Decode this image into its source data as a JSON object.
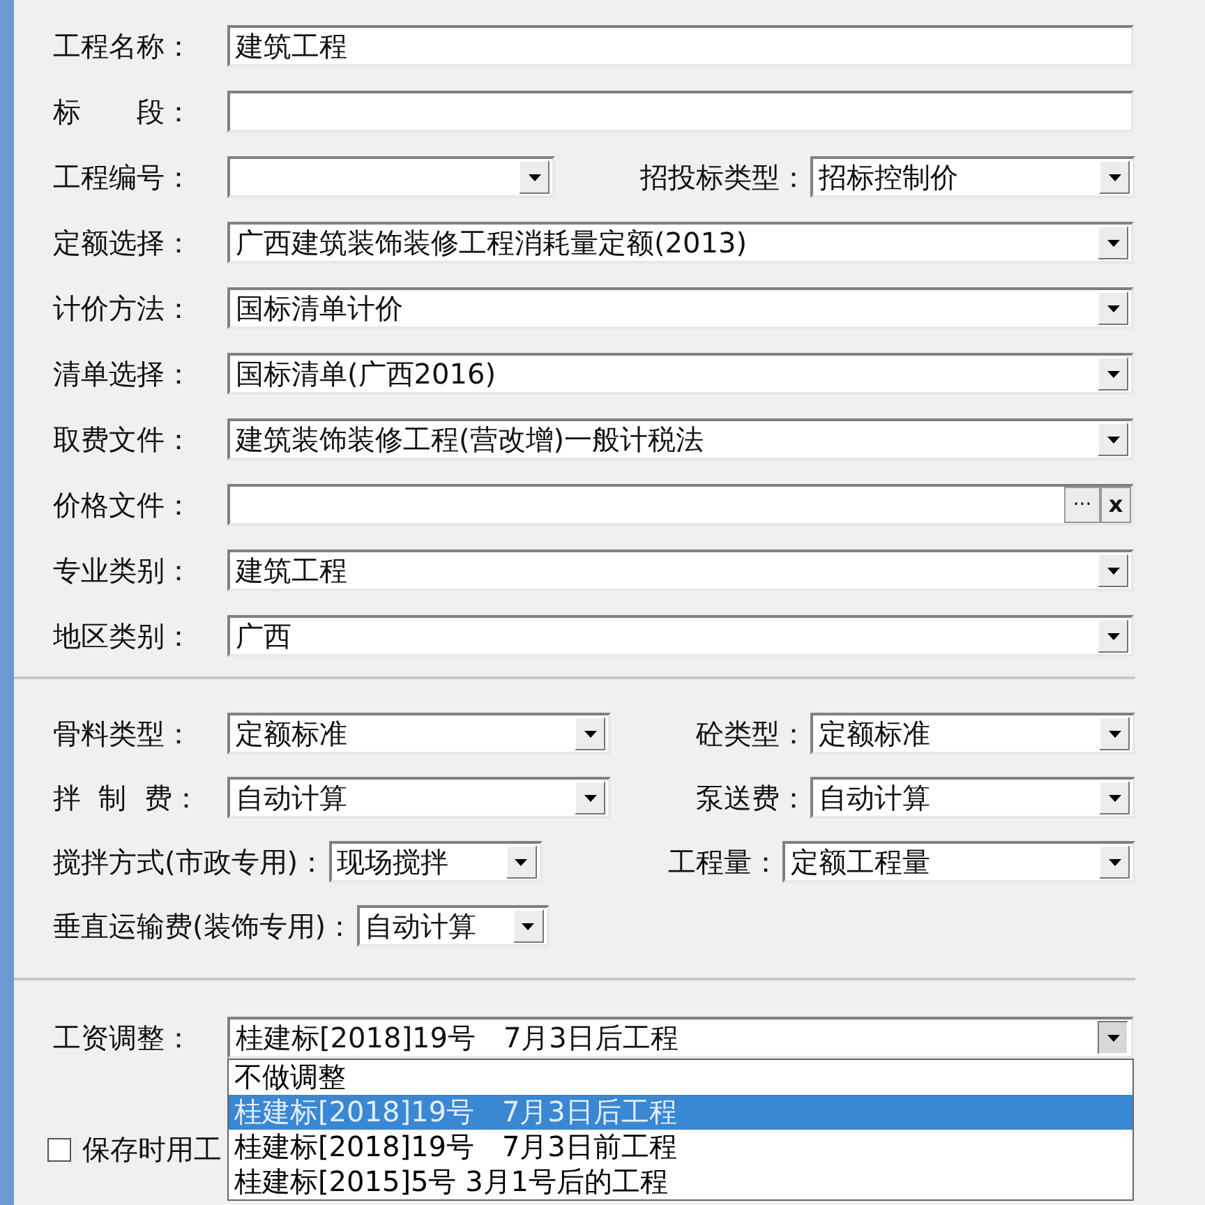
{
  "sections": [
    {
      "rows": [
        {
          "kind": "single",
          "fields": [
            {
              "label": "工程名称：",
              "kind": "text",
              "value": "建筑工程"
            }
          ]
        },
        {
          "kind": "single",
          "fields": [
            {
              "label": "标　　段：",
              "kind": "text"
            }
          ]
        },
        {
          "kind": "narrowpair",
          "fields": [
            {
              "label": "工程编号：",
              "kind": "combo"
            },
            {
              "label": "招投标类型：",
              "kind": "combo",
              "value": "招标控制价"
            }
          ]
        },
        {
          "kind": "single",
          "fields": [
            {
              "label": "定额选择：",
              "kind": "combo",
              "value": "广西建筑装饰装修工程消耗量定额(2013)"
            }
          ]
        },
        {
          "kind": "single",
          "fields": [
            {
              "label": "计价方法：",
              "kind": "combo",
              "value": "国标清单计价"
            }
          ]
        },
        {
          "kind": "single",
          "fields": [
            {
              "label": "清单选择：",
              "kind": "combo",
              "value": "国标清单(广西2016)"
            }
          ]
        },
        {
          "kind": "single",
          "fields": [
            {
              "label": "取费文件：",
              "kind": "combo",
              "value": "建筑装饰装修工程(营改增)一般计税法"
            }
          ]
        },
        {
          "kind": "single",
          "fields": [
            {
              "label": "价格文件：",
              "kind": "file",
              "browse": "···",
              "clear": "x"
            }
          ]
        },
        {
          "kind": "single",
          "fields": [
            {
              "label": "专业类别：",
              "kind": "combo",
              "value": "建筑工程"
            }
          ]
        },
        {
          "kind": "single",
          "fields": [
            {
              "label": "地区类别：",
              "kind": "combo",
              "value": "广西"
            }
          ]
        }
      ]
    },
    {
      "rows": [
        {
          "kind": "pair",
          "fields": [
            {
              "label": "骨料类型：",
              "kind": "combo",
              "value": "定额标准"
            },
            {
              "label": "砼类型：",
              "kind": "combo",
              "value": "定额标准"
            }
          ]
        },
        {
          "kind": "pair",
          "fields": [
            {
              "label": "拌  制  费：",
              "kind": "combo",
              "value": "自动计算"
            },
            {
              "label": "泵送费：",
              "kind": "combo",
              "value": "自动计算"
            }
          ]
        },
        {
          "kind": "widepair",
          "fields": [
            {
              "label": "搅拌方式(市政专用)：",
              "kind": "combo",
              "value": "现场搅拌"
            },
            {
              "label": "工程量：",
              "kind": "combo",
              "value": "定额工程量"
            }
          ]
        },
        {
          "kind": "short",
          "fields": [
            {
              "label": "垂直运输费(装饰专用)：",
              "kind": "combo",
              "value": "自动计算"
            }
          ]
        }
      ]
    },
    {
      "rows": [
        {
          "kind": "single",
          "fields": [
            {
              "label": "工资调整：",
              "kind": "combo",
              "value": "桂建标[2018]19号　7月3日后工程",
              "expanded": true,
              "options": [
                {
                  "text": "不做调整",
                  "selected": false
                },
                {
                  "text": "桂建标[2018]19号　7月3日后工程",
                  "selected": true
                },
                {
                  "text": "桂建标[2018]19号　7月3日前工程",
                  "selected": false
                },
                {
                  "text": "桂建标[2015]5号 3月1号后的工程",
                  "selected": false
                }
              ]
            }
          ]
        }
      ]
    }
  ],
  "save_option": {
    "label": "保存时用工",
    "checked": false
  }
}
